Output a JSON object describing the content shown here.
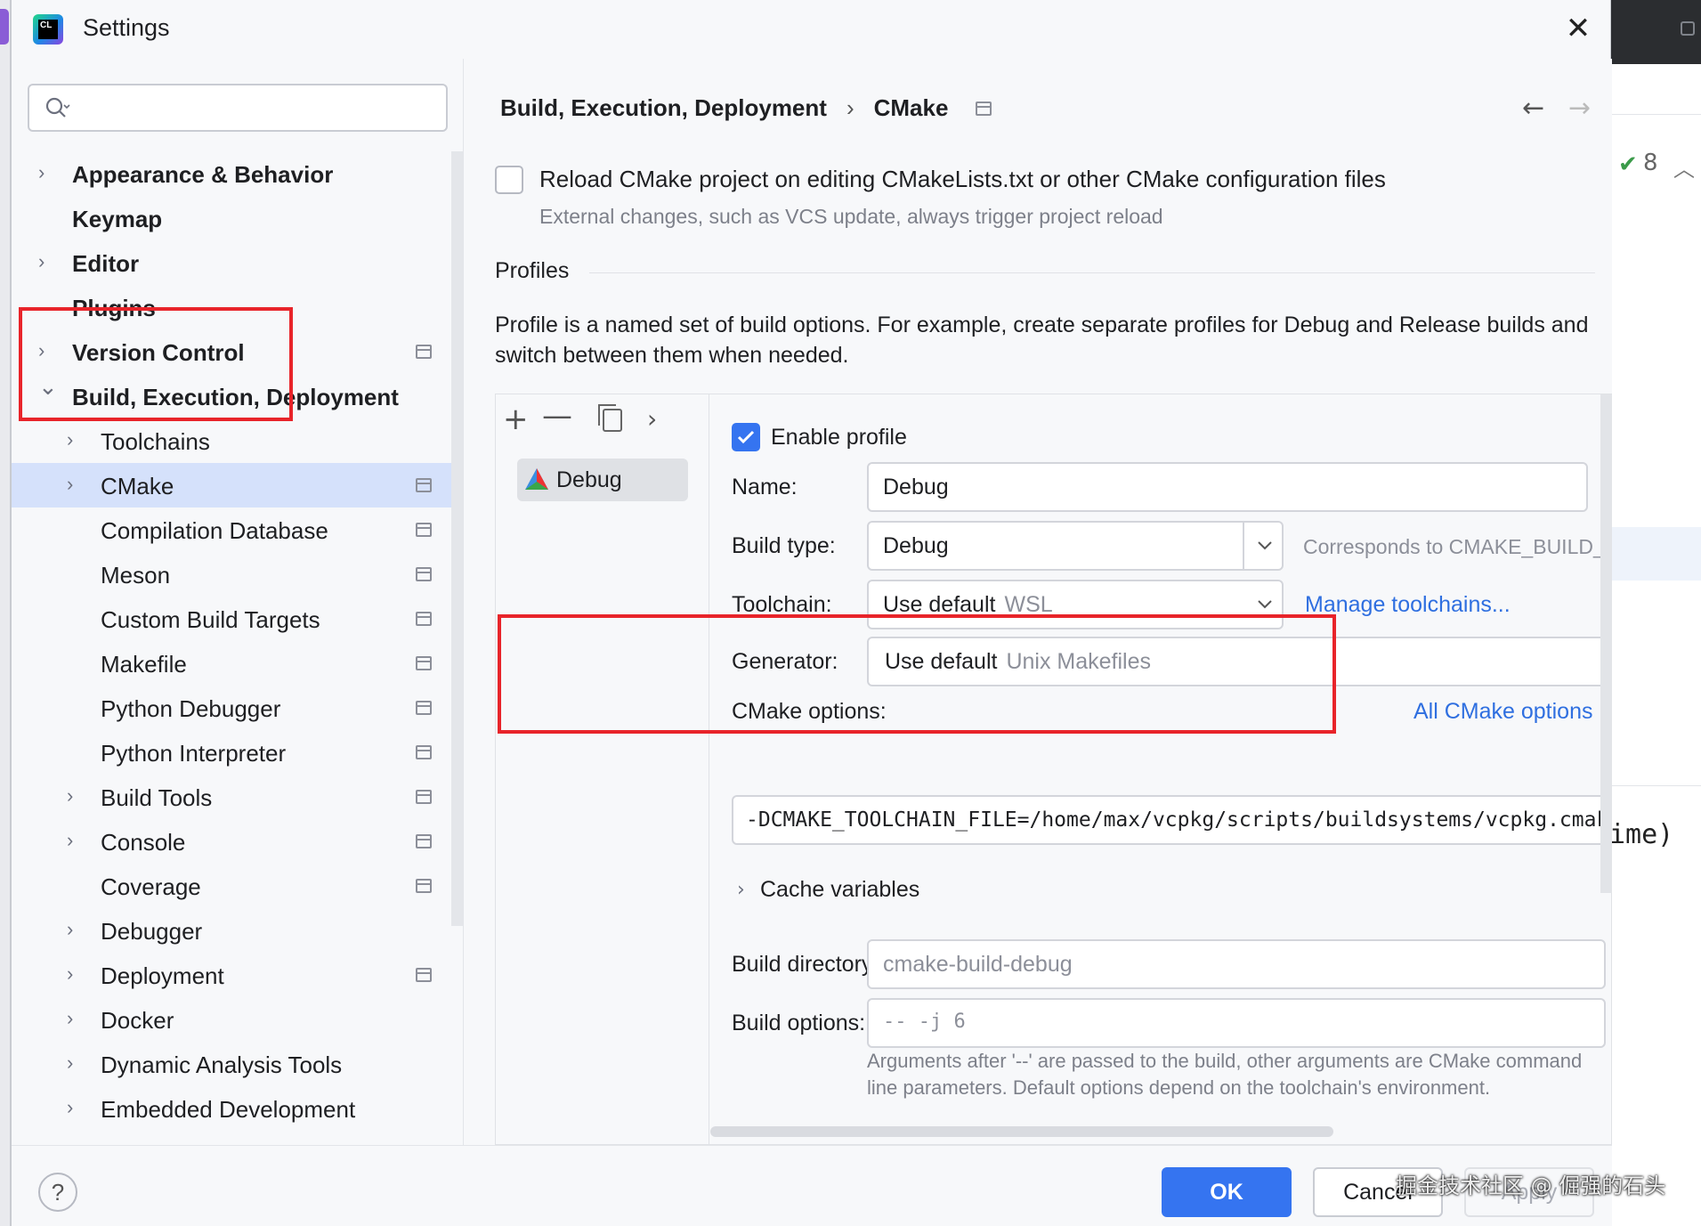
{
  "window": {
    "title": "Settings"
  },
  "search": {
    "placeholder": ""
  },
  "sidebar": {
    "items": [
      {
        "label": "Appearance & Behavior",
        "level": 0,
        "expandable": true,
        "expanded": false,
        "pinned": false
      },
      {
        "label": "Keymap",
        "level": 0,
        "expandable": false,
        "pinned": false
      },
      {
        "label": "Editor",
        "level": 0,
        "expandable": true,
        "expanded": false,
        "pinned": false
      },
      {
        "label": "Plugins",
        "level": 0,
        "expandable": false,
        "pinned": false
      },
      {
        "label": "Version Control",
        "level": 0,
        "expandable": true,
        "expanded": false,
        "pinned": true
      },
      {
        "label": "Build, Execution, Deployment",
        "level": 0,
        "expandable": true,
        "expanded": true,
        "pinned": false
      },
      {
        "label": "Toolchains",
        "level": 1,
        "expandable": true,
        "expanded": false,
        "pinned": false
      },
      {
        "label": "CMake",
        "level": 1,
        "expandable": true,
        "expanded": false,
        "pinned": true,
        "selected": true
      },
      {
        "label": "Compilation Database",
        "level": 1,
        "expandable": false,
        "pinned": true
      },
      {
        "label": "Meson",
        "level": 1,
        "expandable": false,
        "pinned": true
      },
      {
        "label": "Custom Build Targets",
        "level": 1,
        "expandable": false,
        "pinned": true
      },
      {
        "label": "Makefile",
        "level": 1,
        "expandable": false,
        "pinned": true
      },
      {
        "label": "Python Debugger",
        "level": 1,
        "expandable": false,
        "pinned": true
      },
      {
        "label": "Python Interpreter",
        "level": 1,
        "expandable": false,
        "pinned": true
      },
      {
        "label": "Build Tools",
        "level": 1,
        "expandable": true,
        "expanded": false,
        "pinned": true
      },
      {
        "label": "Console",
        "level": 1,
        "expandable": true,
        "expanded": false,
        "pinned": true
      },
      {
        "label": "Coverage",
        "level": 1,
        "expandable": false,
        "pinned": true
      },
      {
        "label": "Debugger",
        "level": 1,
        "expandable": true,
        "expanded": false,
        "pinned": false
      },
      {
        "label": "Deployment",
        "level": 1,
        "expandable": true,
        "expanded": false,
        "pinned": true
      },
      {
        "label": "Docker",
        "level": 1,
        "expandable": true,
        "expanded": false,
        "pinned": false
      },
      {
        "label": "Dynamic Analysis Tools",
        "level": 1,
        "expandable": true,
        "expanded": false,
        "pinned": false
      },
      {
        "label": "Embedded Development",
        "level": 1,
        "expandable": true,
        "expanded": false,
        "pinned": false
      }
    ]
  },
  "breadcrumb": {
    "parent": "Build, Execution, Deployment",
    "separator": "›",
    "current": "CMake"
  },
  "nav": {
    "back": "←",
    "forward": "→"
  },
  "reload": {
    "checked": false,
    "label": "Reload CMake project on editing CMakeLists.txt or other CMake configuration files",
    "hint": "External changes, such as VCS update, always trigger project reload"
  },
  "profiles": {
    "title": "Profiles",
    "description": "Profile is a named set of build options. For example, create separate profiles for Debug and Release builds and switch between them when needed.",
    "toolbar": {
      "add": "+",
      "remove": "—",
      "more": "›"
    },
    "list": [
      {
        "name": "Debug",
        "selected": true
      }
    ]
  },
  "form": {
    "enable_profile": {
      "label": "Enable profile",
      "checked": true
    },
    "name": {
      "label": "Name:",
      "value": "Debug"
    },
    "build_type": {
      "label": "Build type:",
      "value": "Debug",
      "hint": "Corresponds to CMAKE_BUILD_TYPE"
    },
    "toolchain": {
      "label": "Toolchain:",
      "value": "Use default",
      "muted": "WSL",
      "link": "Manage toolchains..."
    },
    "generator": {
      "label": "Generator:",
      "value": "Use default",
      "muted": "Unix Makefiles"
    },
    "cmake_options": {
      "label": "CMake options:",
      "link": "All CMake options",
      "value": "-DCMAKE_TOOLCHAIN_FILE=/home/max/vcpkg/scripts/buildsystems/vcpkg.cmake"
    },
    "cache_variables": {
      "label": "Cache variables"
    },
    "build_directory": {
      "label": "Build directory:",
      "placeholder": "cmake-build-debug"
    },
    "build_options": {
      "label": "Build options:",
      "placeholder": "-- -j 6",
      "hint": "Arguments after '--' are passed to the build, other arguments are CMake command line parameters. Default options depend on the toolchain's environment."
    }
  },
  "buttons": {
    "ok": "OK",
    "cancel": "Cancel",
    "apply": "Apply",
    "help": "?"
  },
  "background": {
    "ide_badge_count": "8",
    "ime_text": "ime)"
  },
  "watermark": "掘金技术社区 @ 倔强的石头",
  "colors": {
    "accent": "#3574f0",
    "selection": "#d5e1fb",
    "highlight_box": "#e8242a",
    "link": "#2f6fe0"
  }
}
